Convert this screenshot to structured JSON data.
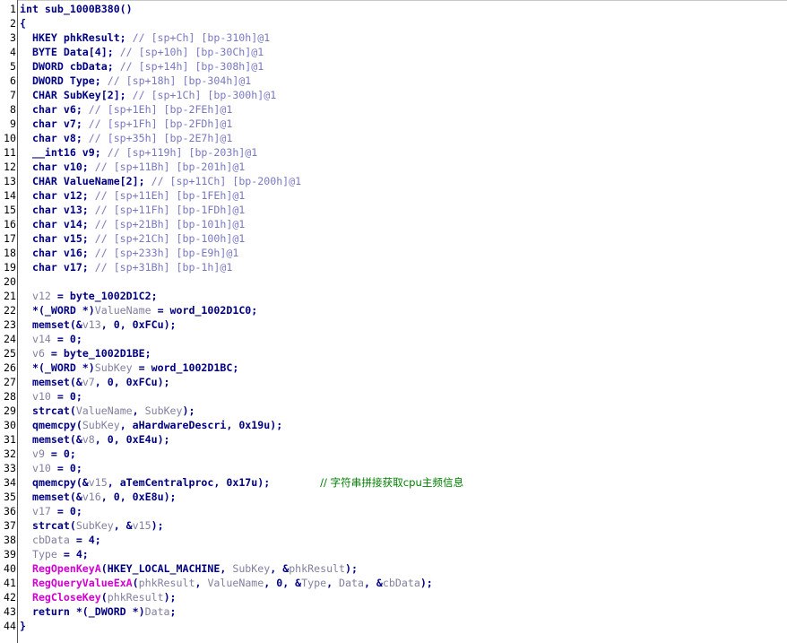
{
  "code_view": {
    "function_name": "sub_1000B380",
    "colors": {
      "keyword": "#000080",
      "comment": "#7878c0",
      "variable": "#8080a0",
      "api_call": "#d000d0",
      "chinese_comment": "#008000"
    },
    "lines": [
      {
        "n": "1",
        "segs": [
          {
            "t": "int sub_1000B380()",
            "c": "k"
          }
        ]
      },
      {
        "n": "2",
        "segs": [
          {
            "t": "{",
            "c": "k"
          }
        ]
      },
      {
        "n": "3",
        "segs": [
          {
            "t": "  HKEY phkResult; ",
            "c": "k"
          },
          {
            "t": "// [sp+Ch] [bp-310h]@1",
            "c": "cm"
          }
        ]
      },
      {
        "n": "4",
        "segs": [
          {
            "t": "  BYTE Data[4]; ",
            "c": "k"
          },
          {
            "t": "// [sp+10h] [bp-30Ch]@1",
            "c": "cm"
          }
        ]
      },
      {
        "n": "5",
        "segs": [
          {
            "t": "  DWORD cbData; ",
            "c": "k"
          },
          {
            "t": "// [sp+14h] [bp-308h]@1",
            "c": "cm"
          }
        ]
      },
      {
        "n": "6",
        "segs": [
          {
            "t": "  DWORD Type; ",
            "c": "k"
          },
          {
            "t": "// [sp+18h] [bp-304h]@1",
            "c": "cm"
          }
        ]
      },
      {
        "n": "7",
        "segs": [
          {
            "t": "  CHAR SubKey[2]; ",
            "c": "k"
          },
          {
            "t": "// [sp+1Ch] [bp-300h]@1",
            "c": "cm"
          }
        ]
      },
      {
        "n": "8",
        "segs": [
          {
            "t": "  char v6; ",
            "c": "k"
          },
          {
            "t": "// [sp+1Eh] [bp-2FEh]@1",
            "c": "cm"
          }
        ]
      },
      {
        "n": "9",
        "segs": [
          {
            "t": "  char v7; ",
            "c": "k"
          },
          {
            "t": "// [sp+1Fh] [bp-2FDh]@1",
            "c": "cm"
          }
        ]
      },
      {
        "n": "10",
        "segs": [
          {
            "t": "  char v8; ",
            "c": "k"
          },
          {
            "t": "// [sp+35h] [bp-2E7h]@1",
            "c": "cm"
          }
        ]
      },
      {
        "n": "11",
        "segs": [
          {
            "t": "  __int16 v9; ",
            "c": "k"
          },
          {
            "t": "// [sp+119h] [bp-203h]@1",
            "c": "cm"
          }
        ]
      },
      {
        "n": "12",
        "segs": [
          {
            "t": "  char v10; ",
            "c": "k"
          },
          {
            "t": "// [sp+11Bh] [bp-201h]@1",
            "c": "cm"
          }
        ]
      },
      {
        "n": "13",
        "segs": [
          {
            "t": "  CHAR ValueName[2]; ",
            "c": "k"
          },
          {
            "t": "// [sp+11Ch] [bp-200h]@1",
            "c": "cm"
          }
        ]
      },
      {
        "n": "14",
        "segs": [
          {
            "t": "  char v12; ",
            "c": "k"
          },
          {
            "t": "// [sp+11Eh] [bp-1FEh]@1",
            "c": "cm"
          }
        ]
      },
      {
        "n": "15",
        "segs": [
          {
            "t": "  char v13; ",
            "c": "k"
          },
          {
            "t": "// [sp+11Fh] [bp-1FDh]@1",
            "c": "cm"
          }
        ]
      },
      {
        "n": "16",
        "segs": [
          {
            "t": "  char v14; ",
            "c": "k"
          },
          {
            "t": "// [sp+21Bh] [bp-101h]@1",
            "c": "cm"
          }
        ]
      },
      {
        "n": "17",
        "segs": [
          {
            "t": "  char v15; ",
            "c": "k"
          },
          {
            "t": "// [sp+21Ch] [bp-100h]@1",
            "c": "cm"
          }
        ]
      },
      {
        "n": "18",
        "segs": [
          {
            "t": "  char v16; ",
            "c": "k"
          },
          {
            "t": "// [sp+233h] [bp-E9h]@1",
            "c": "cm"
          }
        ]
      },
      {
        "n": "19",
        "segs": [
          {
            "t": "  char v17; ",
            "c": "k"
          },
          {
            "t": "// [sp+31Bh] [bp-1h]@1",
            "c": "cm"
          }
        ]
      },
      {
        "n": "20",
        "segs": [
          {
            "t": "",
            "c": "k"
          }
        ]
      },
      {
        "n": "21",
        "segs": [
          {
            "t": "  ",
            "c": "k"
          },
          {
            "t": "v12",
            "c": "v"
          },
          {
            "t": " = byte_1002D1C2;",
            "c": "k"
          }
        ]
      },
      {
        "n": "22",
        "segs": [
          {
            "t": "  *(_WORD *)",
            "c": "k"
          },
          {
            "t": "ValueName",
            "c": "v"
          },
          {
            "t": " = word_1002D1C0;",
            "c": "k"
          }
        ]
      },
      {
        "n": "23",
        "segs": [
          {
            "t": "  memset(&",
            "c": "k"
          },
          {
            "t": "v13",
            "c": "v"
          },
          {
            "t": ", 0, 0xFCu);",
            "c": "k"
          }
        ]
      },
      {
        "n": "24",
        "segs": [
          {
            "t": "  ",
            "c": "k"
          },
          {
            "t": "v14",
            "c": "v"
          },
          {
            "t": " = 0;",
            "c": "k"
          }
        ]
      },
      {
        "n": "25",
        "segs": [
          {
            "t": "  ",
            "c": "k"
          },
          {
            "t": "v6",
            "c": "v"
          },
          {
            "t": " = byte_1002D1BE;",
            "c": "k"
          }
        ]
      },
      {
        "n": "26",
        "segs": [
          {
            "t": "  *(_WORD *)",
            "c": "k"
          },
          {
            "t": "SubKey",
            "c": "v"
          },
          {
            "t": " = word_1002D1BC;",
            "c": "k"
          }
        ]
      },
      {
        "n": "27",
        "segs": [
          {
            "t": "  memset(&",
            "c": "k"
          },
          {
            "t": "v7",
            "c": "v"
          },
          {
            "t": ", 0, 0xFCu);",
            "c": "k"
          }
        ]
      },
      {
        "n": "28",
        "segs": [
          {
            "t": "  ",
            "c": "k"
          },
          {
            "t": "v10",
            "c": "v"
          },
          {
            "t": " = 0;",
            "c": "k"
          }
        ]
      },
      {
        "n": "29",
        "segs": [
          {
            "t": "  strcat(",
            "c": "k"
          },
          {
            "t": "ValueName",
            "c": "v"
          },
          {
            "t": ", ",
            "c": "k"
          },
          {
            "t": "SubKey",
            "c": "v"
          },
          {
            "t": ");",
            "c": "k"
          }
        ]
      },
      {
        "n": "30",
        "segs": [
          {
            "t": "  qmemcpy(",
            "c": "k"
          },
          {
            "t": "SubKey",
            "c": "v"
          },
          {
            "t": ", aHardwareDescri, 0x19u);",
            "c": "k"
          }
        ]
      },
      {
        "n": "31",
        "segs": [
          {
            "t": "  memset(&",
            "c": "k"
          },
          {
            "t": "v8",
            "c": "v"
          },
          {
            "t": ", 0, 0xE4u);",
            "c": "k"
          }
        ]
      },
      {
        "n": "32",
        "segs": [
          {
            "t": "  ",
            "c": "k"
          },
          {
            "t": "v9",
            "c": "v"
          },
          {
            "t": " = 0;",
            "c": "k"
          }
        ]
      },
      {
        "n": "33",
        "segs": [
          {
            "t": "  ",
            "c": "k"
          },
          {
            "t": "v10",
            "c": "v"
          },
          {
            "t": " = 0;",
            "c": "k"
          }
        ]
      },
      {
        "n": "34",
        "segs": [
          {
            "t": "  qmemcpy(&",
            "c": "k"
          },
          {
            "t": "v15",
            "c": "v"
          },
          {
            "t": ", aTemCentralproc, 0x17u);        ",
            "c": "k"
          },
          {
            "t": "// 字符串拼接获取cpu主频信息",
            "c": "z"
          }
        ]
      },
      {
        "n": "35",
        "segs": [
          {
            "t": "  memset(&",
            "c": "k"
          },
          {
            "t": "v16",
            "c": "v"
          },
          {
            "t": ", 0, 0xE8u);",
            "c": "k"
          }
        ]
      },
      {
        "n": "36",
        "segs": [
          {
            "t": "  ",
            "c": "k"
          },
          {
            "t": "v17",
            "c": "v"
          },
          {
            "t": " = 0;",
            "c": "k"
          }
        ]
      },
      {
        "n": "37",
        "segs": [
          {
            "t": "  strcat(",
            "c": "k"
          },
          {
            "t": "SubKey",
            "c": "v"
          },
          {
            "t": ", &",
            "c": "k"
          },
          {
            "t": "v15",
            "c": "v"
          },
          {
            "t": ");",
            "c": "k"
          }
        ]
      },
      {
        "n": "38",
        "segs": [
          {
            "t": "  ",
            "c": "k"
          },
          {
            "t": "cbData",
            "c": "v"
          },
          {
            "t": " = 4;",
            "c": "k"
          }
        ]
      },
      {
        "n": "39",
        "segs": [
          {
            "t": "  ",
            "c": "k"
          },
          {
            "t": "Type",
            "c": "v"
          },
          {
            "t": " = 4;",
            "c": "k"
          }
        ]
      },
      {
        "n": "40",
        "segs": [
          {
            "t": "  ",
            "c": "k"
          },
          {
            "t": "RegOpenKeyA",
            "c": "f"
          },
          {
            "t": "(HKEY_LOCAL_MACHINE, ",
            "c": "k"
          },
          {
            "t": "SubKey",
            "c": "v"
          },
          {
            "t": ", &",
            "c": "k"
          },
          {
            "t": "phkResult",
            "c": "v"
          },
          {
            "t": ");",
            "c": "k"
          }
        ]
      },
      {
        "n": "41",
        "segs": [
          {
            "t": "  ",
            "c": "k"
          },
          {
            "t": "RegQueryValueExA",
            "c": "f"
          },
          {
            "t": "(",
            "c": "k"
          },
          {
            "t": "phkResult",
            "c": "v"
          },
          {
            "t": ", ",
            "c": "k"
          },
          {
            "t": "ValueName",
            "c": "v"
          },
          {
            "t": ", 0, &",
            "c": "k"
          },
          {
            "t": "Type",
            "c": "v"
          },
          {
            "t": ", ",
            "c": "k"
          },
          {
            "t": "Data",
            "c": "v"
          },
          {
            "t": ", &",
            "c": "k"
          },
          {
            "t": "cbData",
            "c": "v"
          },
          {
            "t": ");",
            "c": "k"
          }
        ]
      },
      {
        "n": "42",
        "segs": [
          {
            "t": "  ",
            "c": "k"
          },
          {
            "t": "RegCloseKey",
            "c": "f"
          },
          {
            "t": "(",
            "c": "k"
          },
          {
            "t": "phkResult",
            "c": "v"
          },
          {
            "t": ");",
            "c": "k"
          }
        ]
      },
      {
        "n": "43",
        "segs": [
          {
            "t": "  return *(_DWORD *)",
            "c": "k"
          },
          {
            "t": "Data",
            "c": "v"
          },
          {
            "t": ";",
            "c": "k"
          }
        ]
      },
      {
        "n": "44",
        "segs": [
          {
            "t": "}",
            "c": "k"
          }
        ]
      }
    ]
  }
}
